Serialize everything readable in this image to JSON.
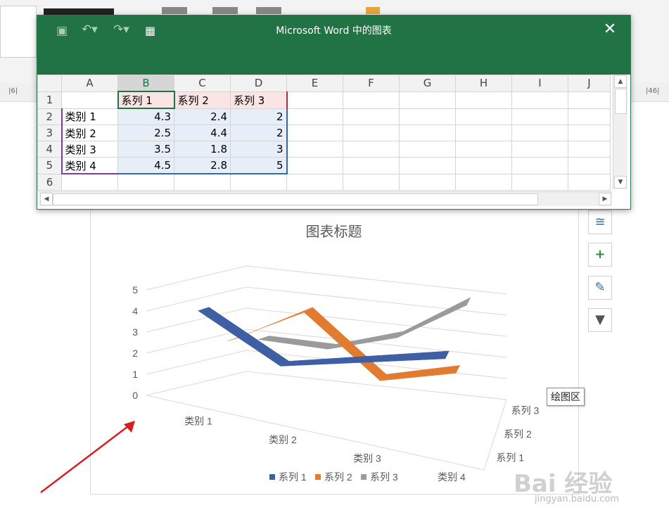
{
  "window": {
    "title": "Microsoft Word 中的图表"
  },
  "spreadsheet": {
    "columns": [
      "A",
      "B",
      "C",
      "D",
      "E",
      "F",
      "G",
      "H",
      "I",
      "J"
    ],
    "rows": [
      "1",
      "2",
      "3",
      "4",
      "5",
      "6"
    ],
    "headers": [
      "",
      "系列 1",
      "系列 2",
      "系列 3"
    ],
    "data": [
      [
        "类别 1",
        "4.3",
        "2.4",
        "2"
      ],
      [
        "类别 2",
        "2.5",
        "4.4",
        "2"
      ],
      [
        "类别 3",
        "3.5",
        "1.8",
        "3"
      ],
      [
        "类别 4",
        "4.5",
        "2.8",
        "5"
      ]
    ]
  },
  "ruler": {
    "left_text": "|6|",
    "right_text": "|46|"
  },
  "chart_data": {
    "type": "line",
    "title": "图表标题",
    "categories": [
      "类别 1",
      "类别 2",
      "类别 3",
      "类别 4"
    ],
    "series": [
      {
        "name": "系列 1",
        "values": [
          4.3,
          2.5,
          3.5,
          4.5
        ],
        "color": "#3e5fa4"
      },
      {
        "name": "系列 2",
        "values": [
          2.4,
          4.4,
          1.8,
          2.8
        ],
        "color": "#e07b2f"
      },
      {
        "name": "系列 3",
        "values": [
          2,
          2,
          3,
          5
        ],
        "color": "#9b9b9b"
      }
    ],
    "y_ticks": [
      "0",
      "1",
      "2",
      "3",
      "4",
      "5"
    ],
    "ylim": [
      0,
      5
    ],
    "depth_labels": [
      "系列 3",
      "系列 2",
      "系列 1"
    ],
    "legend_position": "bottom",
    "grid": true
  },
  "tooltip": "绘图区",
  "watermark": {
    "brand": "Bai 经验",
    "url": "jingyan.baidu.com"
  },
  "colors": {
    "excel_green": "#217346",
    "arrow_red": "#d81e1e"
  }
}
